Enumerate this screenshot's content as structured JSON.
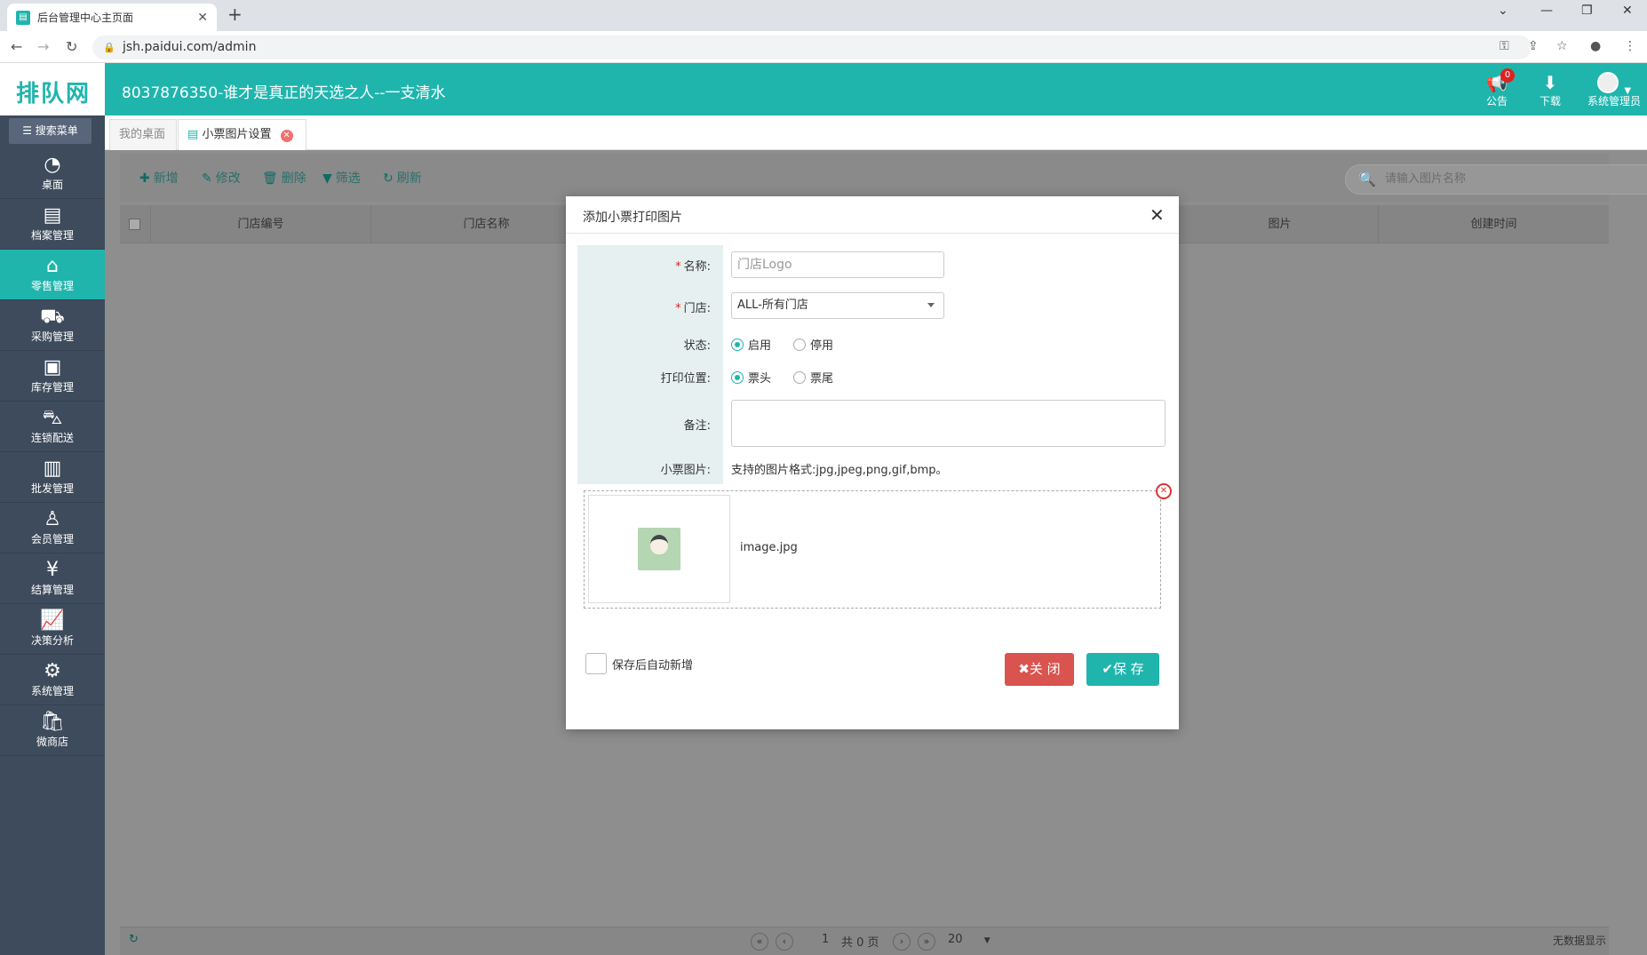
{
  "browser": {
    "tab_title": "后台管理中心主页面",
    "url": "jsh.paidui.com/admin"
  },
  "header": {
    "logo": "排队网",
    "title": "8037876350-谁才是真正的天选之人--一支清水",
    "notice_label": "公告",
    "notice_count": "0",
    "download_label": "下载",
    "user_label": "系统管理员"
  },
  "sidebar": {
    "search_label": "搜索菜单",
    "items": [
      {
        "label": "桌面",
        "icon": "dashboard-icon"
      },
      {
        "label": "档案管理",
        "icon": "file-icon"
      },
      {
        "label": "零售管理",
        "icon": "store-icon"
      },
      {
        "label": "采购管理",
        "icon": "cart-icon"
      },
      {
        "label": "库存管理",
        "icon": "inventory-icon"
      },
      {
        "label": "连锁配送",
        "icon": "truck-icon"
      },
      {
        "label": "批发管理",
        "icon": "wholesale-icon"
      },
      {
        "label": "会员管理",
        "icon": "member-icon"
      },
      {
        "label": "结算管理",
        "icon": "settlement-icon"
      },
      {
        "label": "决策分析",
        "icon": "chart-icon"
      },
      {
        "label": "系统管理",
        "icon": "gear-icon"
      },
      {
        "label": "微商店",
        "icon": "shop-icon"
      }
    ]
  },
  "content_tabs": {
    "tab1": "我的桌面",
    "tab2": "小票图片设置"
  },
  "toolbar": {
    "add": "新增",
    "edit": "修改",
    "delete": "删除",
    "filter": "筛选",
    "refresh": "刷新",
    "search_placeholder": "请输入图片名称",
    "search_btn": "搜索"
  },
  "grid": {
    "columns": [
      "门店编号",
      "门店名称",
      "图片",
      "创建时间"
    ]
  },
  "pager": {
    "page": "1",
    "total": "共 0 页",
    "size": "20",
    "status": "无数据显示"
  },
  "modal": {
    "title": "添加小票打印图片",
    "name_label": "名称:",
    "name_value": "门店Logo",
    "store_label": "门店:",
    "store_value": "ALL-所有门店",
    "status_label": "状态:",
    "status_on": "启用",
    "status_off": "停用",
    "position_label": "打印位置:",
    "pos_head": "票头",
    "pos_tail": "票尾",
    "remark_label": "备注:",
    "image_label": "小票图片:",
    "image_hint": "支持的图片格式:jpg,jpeg,png,gif,bmp。",
    "file_name": "image.jpg",
    "auto_add": "保存后自动新增",
    "close_btn": "关 闭",
    "save_btn": "保 存"
  }
}
